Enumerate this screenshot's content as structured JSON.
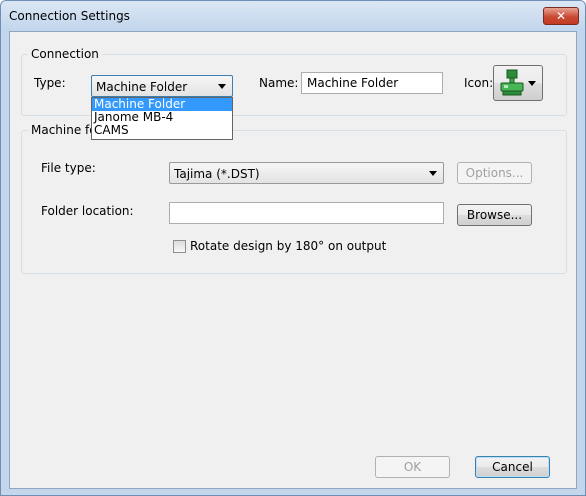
{
  "window": {
    "title": "Connection Settings",
    "close_glyph": "✕"
  },
  "connection": {
    "group_title": "Connection",
    "type_label": "Type:",
    "type_value": "Machine Folder",
    "type_options": [
      "Machine Folder",
      "Janome MB-4",
      "CAMS"
    ],
    "name_label": "Name:",
    "name_value": "Machine Folder",
    "icon_label": "Icon:",
    "icon": "embroidery-machine-icon"
  },
  "machine_folder": {
    "group_title": "Machine fo",
    "file_type_label": "File type:",
    "file_type_value": "Tajima (*.DST)",
    "options_button": "Options...",
    "folder_location_label": "Folder location:",
    "folder_location_value": "",
    "browse_button": "Browse...",
    "rotate_label": "Rotate design by 180° on output",
    "rotate_checked": false
  },
  "footer": {
    "ok_button": "OK",
    "cancel_button": "Cancel"
  },
  "colors": {
    "selection": "#3399ff",
    "title_bar": "#c3d6ec",
    "close_button": "#c94a34"
  }
}
